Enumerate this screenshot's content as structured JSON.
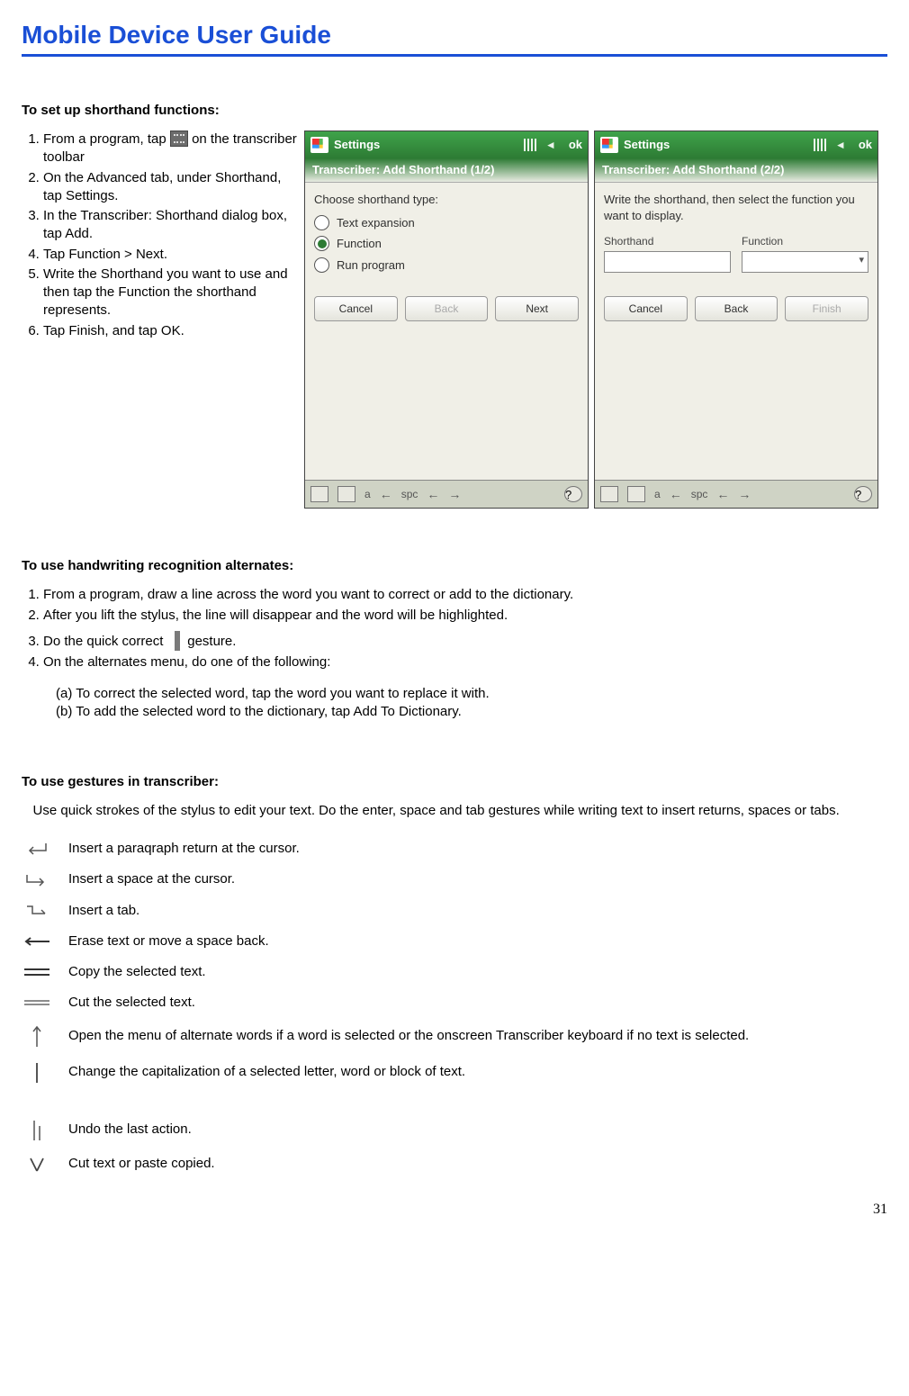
{
  "title": "Mobile Device User Guide",
  "page_number": "31",
  "section1": {
    "heading": "To set up shorthand functions:",
    "steps": [
      "From a program, tap  on the transcriber toolbar",
      "On the Advanced tab, under Shorthand, tap Settings.",
      "In the Transcriber: Shorthand dialog box, tap Add.",
      "Tap Function > Next.",
      "Write the Shorthand you want to use and then tap the Function the shorthand represents.",
      "Tap Finish, and tap OK."
    ]
  },
  "screenshot_a": {
    "title": "Settings",
    "ok": "ok",
    "subtitle": "Transcriber: Add Shorthand (1/2)",
    "prompt": "Choose shorthand type:",
    "options": [
      "Text expansion",
      "Function",
      "Run program"
    ],
    "selected_index": 1,
    "buttons": [
      "Cancel",
      "Back",
      "Next"
    ],
    "bottom_a": "a",
    "bottom_spc": "spc"
  },
  "screenshot_b": {
    "title": "Settings",
    "ok": "ok",
    "subtitle": "Transcriber: Add Shorthand (2/2)",
    "prompt": "Write the shorthand, then select the function you want to display.",
    "labels": [
      "Shorthand",
      "Function"
    ],
    "buttons": [
      "Cancel",
      "Back",
      "Finish"
    ],
    "bottom_a": "a",
    "bottom_spc": "spc"
  },
  "section2": {
    "heading": "To use handwriting recognition alternates:",
    "steps": [
      "From a program, draw a line across the word you want to correct or add to the dictionary.",
      "After you lift the stylus, the line will disappear and the word will be highlighted.",
      "Do the quick correct  gesture.",
      "On the alternates menu, do one of the following:"
    ],
    "sub": [
      "(a)   To correct the selected word, tap the word you want to replace it with.",
      "(b)   To add the selected word to the dictionary, tap Add To Dictionary."
    ]
  },
  "section3": {
    "heading": "To use gestures in transcriber:",
    "intro": "   Use quick strokes of the stylus to edit your text. Do the enter, space and tab gestures while writing text to insert returns, spaces or tabs.",
    "gestures": [
      "Insert a paraqraph return at the cursor.",
      "Insert a space at the cursor.",
      "Insert a tab.",
      "Erase text or move a space back.",
      "Copy the selected text.",
      "Cut the selected text.",
      "Open the menu of alternate words if a word is selected or the onscreen Transcriber keyboard if no text is selected.",
      "Change the capitalization of a selected letter, word or block of text.",
      "Undo the last action.",
      "Cut text or paste copied."
    ]
  }
}
